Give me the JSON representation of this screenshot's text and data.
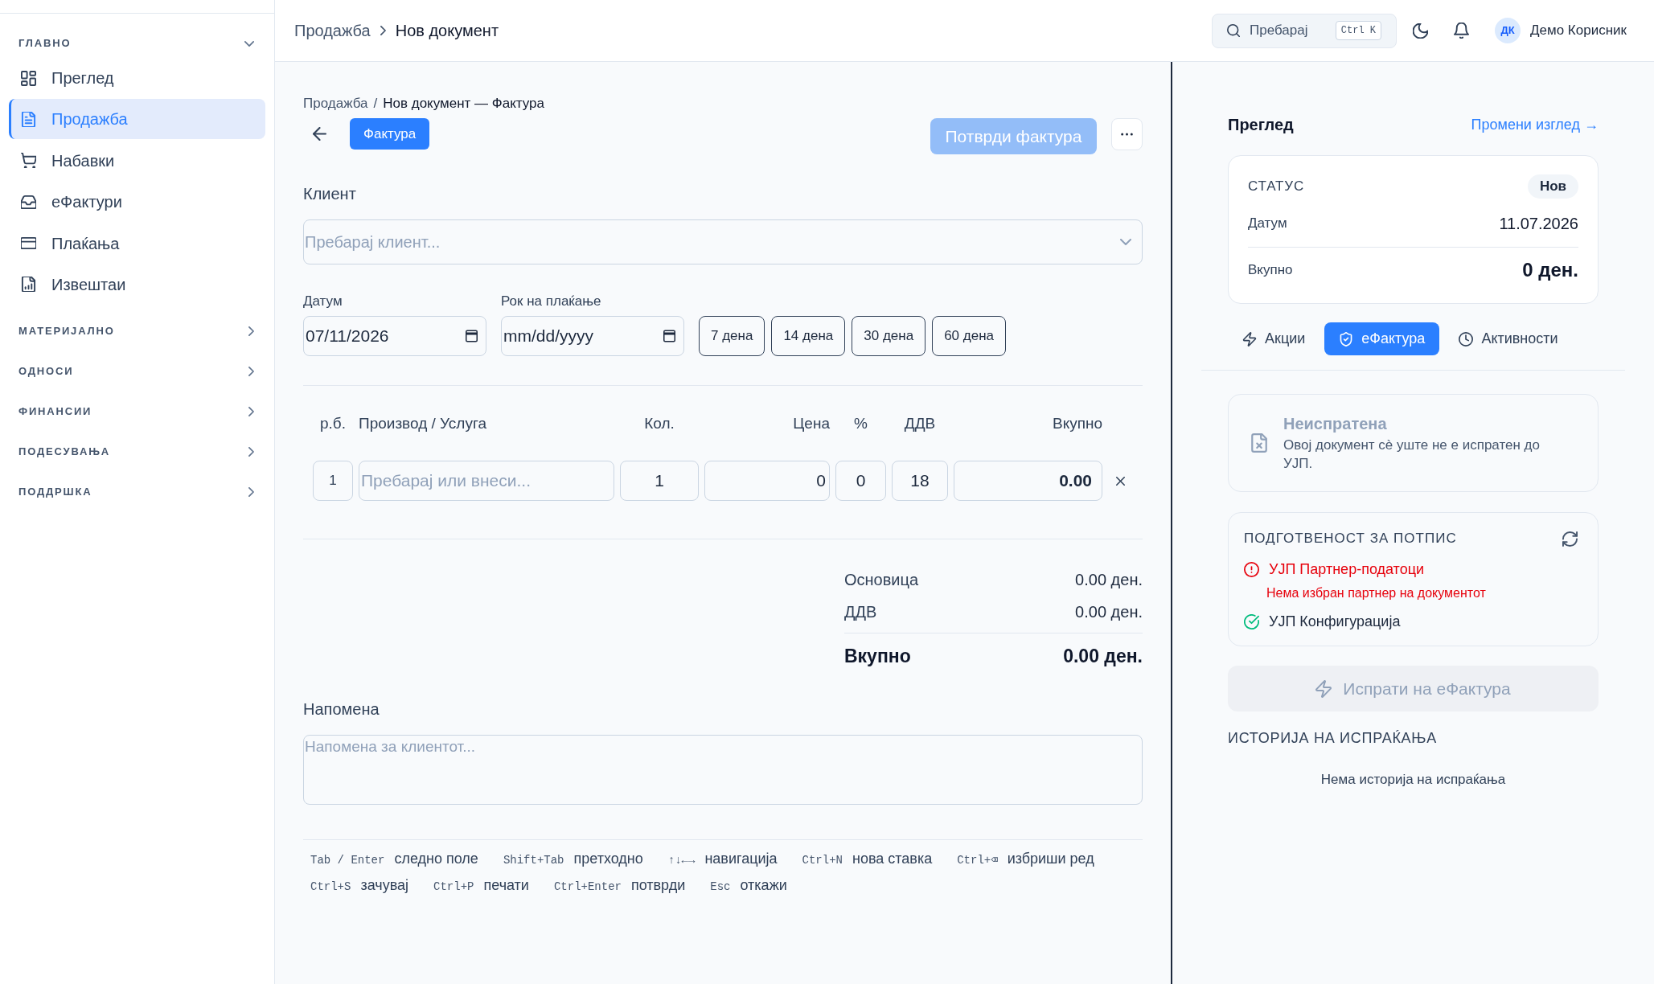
{
  "sidebar": {
    "sections": [
      {
        "title": "ГЛАВНО",
        "expanded": true,
        "items": [
          {
            "label": "Преглед",
            "selected": false
          },
          {
            "label": "Продажба",
            "selected": true
          },
          {
            "label": "Набавки",
            "selected": false
          },
          {
            "label": "еФактури",
            "selected": false
          },
          {
            "label": "Плаќања",
            "selected": false
          },
          {
            "label": "Извештаи",
            "selected": false
          }
        ]
      },
      {
        "title": "МАТЕРИЈАЛНО",
        "expanded": false
      },
      {
        "title": "ОДНОСИ",
        "expanded": false
      },
      {
        "title": "ФИНАНСИИ",
        "expanded": false
      },
      {
        "title": "ПОДЕСУВАЊА",
        "expanded": false
      },
      {
        "title": "ПОДДРШКА",
        "expanded": false
      }
    ]
  },
  "topbar": {
    "breadcrumb": [
      "Продажба",
      "Нов документ"
    ],
    "search": {
      "label": "Пребарај",
      "shortcut": "Ctrl K"
    },
    "user": {
      "initials": "ДК",
      "name": "Демо Корисник"
    }
  },
  "document": {
    "breadcrumb": {
      "items": [
        "Продажба",
        "Нов документ — Фактура"
      ],
      "separator": "/"
    },
    "type_button": "Фактура",
    "confirm_button": {
      "label": "Потврди фактура",
      "disabled": true
    },
    "client": {
      "label": "Клиент",
      "placeholder": "Пребарај клиент..."
    },
    "date": {
      "label": "Датум",
      "value": "07/11/2026"
    },
    "due_date": {
      "label": "Рок на плаќање",
      "placeholder": "mm/dd/yyyy"
    },
    "due_presets": [
      "7 дена",
      "14 дена",
      "30 дена",
      "60 дена"
    ],
    "items_table": {
      "columns": [
        "р.б.",
        "Производ / Услуга",
        "Кол.",
        "Цена",
        "%",
        "ДДВ",
        "Вкупно"
      ],
      "rows": [
        {
          "number": "1",
          "product_placeholder": "Пребарај или внеси...",
          "quantity": "1",
          "price": "0",
          "discount": "0",
          "vat": "18",
          "total": "0.00"
        }
      ]
    },
    "totals": [
      {
        "label": "Основица",
        "value": "0.00 ден.",
        "kind": "subtotal"
      },
      {
        "label": "ДДВ",
        "value": "0.00 ден.",
        "kind": "subtotal"
      },
      {
        "label": "Вкупно",
        "value": "0.00 ден.",
        "kind": "grand_total"
      }
    ],
    "note": {
      "label": "Напомена",
      "placeholder": "Напомена за клиентот..."
    },
    "shortcut_rows": [
      [
        {
          "keys": "Tab / Enter",
          "label": "следно поле"
        },
        {
          "keys": "Shift+Tab",
          "label": "претходно"
        },
        {
          "keys": "↑↓←→",
          "label": "навигација"
        },
        {
          "keys": "Ctrl+N",
          "label": "нова ставка"
        },
        {
          "keys": "Ctrl+⌫",
          "label": "избриши ред"
        }
      ],
      [
        {
          "keys": "Ctrl+S",
          "label": "зачувај"
        },
        {
          "keys": "Ctrl+P",
          "label": "печати"
        },
        {
          "keys": "Ctrl+Enter",
          "label": "потврди"
        },
        {
          "keys": "Esc",
          "label": "откажи"
        }
      ]
    ]
  },
  "preview": {
    "title": "Преглед",
    "link": "Промени изглед →",
    "status": {
      "label": "СТАТУС",
      "value": "Нов"
    },
    "rows": [
      {
        "label": "Датум",
        "value": "11.07.2026",
        "kind": "normal"
      },
      {
        "label": "Вкупно",
        "value": "0 ден.",
        "kind": "total"
      }
    ],
    "tabs": [
      {
        "label": "Акции",
        "selected": false
      },
      {
        "label": "еФактура",
        "selected": true
      },
      {
        "label": "Активности",
        "selected": false
      }
    ],
    "efaktura": {
      "state": {
        "title": "Неиспратена",
        "description": "Овој документ сè уште не е испратен до УЈП."
      },
      "readiness": {
        "title": "ПОДГОТВЕНОСТ ЗА ПОТПИС",
        "checks": [
          {
            "label": "УЈП Партнер-податоци",
            "passed": false,
            "detail": "Нема избран партнер на документот"
          },
          {
            "label": "УЈП Конфигурација",
            "passed": true
          }
        ]
      },
      "send_button": {
        "label": "Испрати на еФактура",
        "disabled": true
      },
      "history": {
        "title": "ИСТОРИЈА НА ИСПРАЌАЊА",
        "empty": "Нема историја на испраќања"
      }
    }
  }
}
